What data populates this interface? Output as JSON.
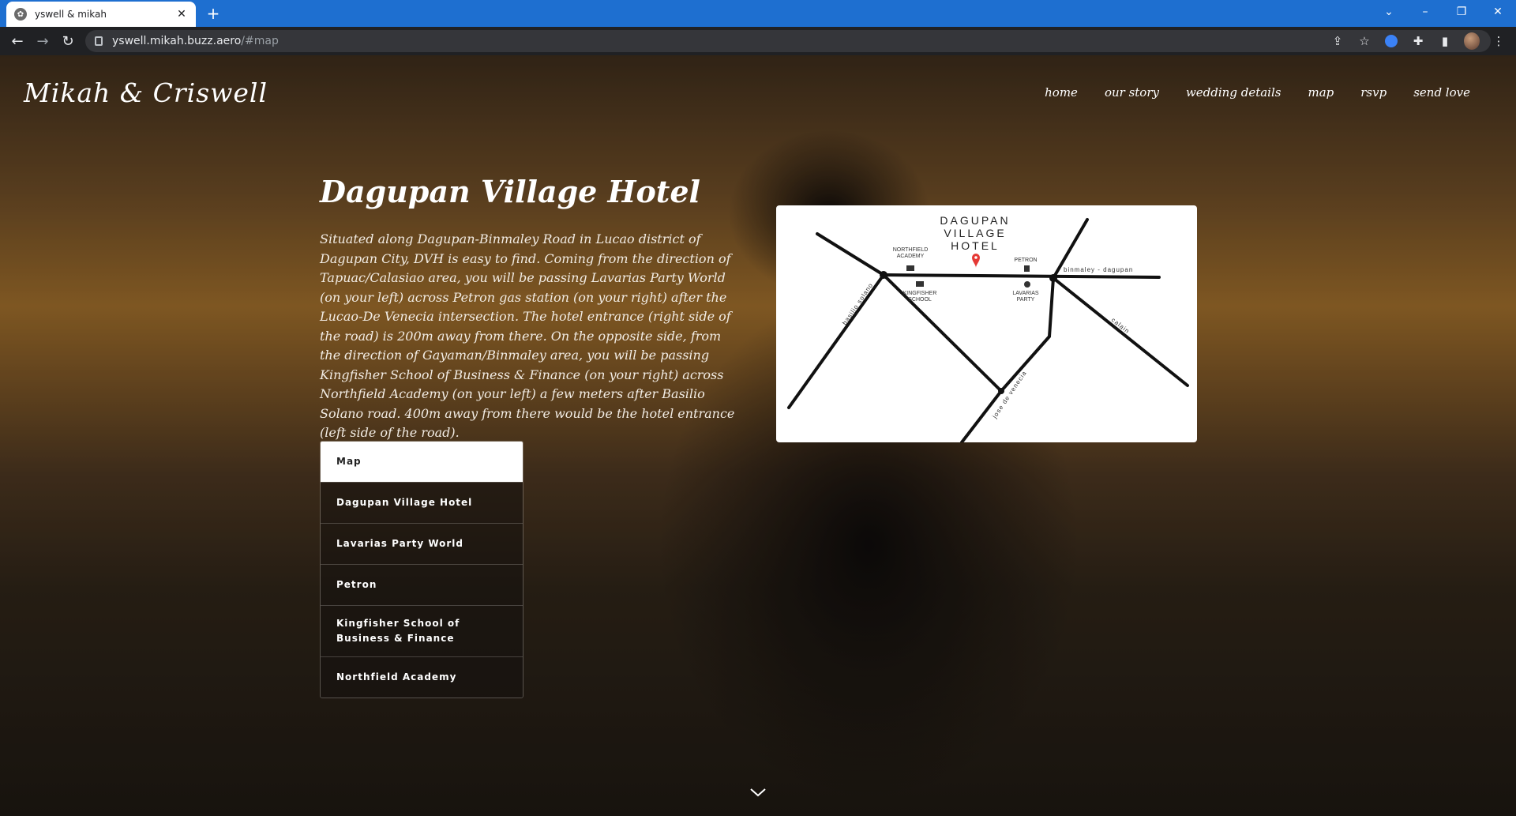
{
  "browser": {
    "tab_title": "yswell & mikah",
    "url_host": "yswell.mikah.buzz.aero",
    "url_path": "/#map"
  },
  "site": {
    "title": "Mikah & Criswell",
    "nav": [
      "home",
      "our story",
      "wedding details",
      "map",
      "rsvp",
      "send love"
    ]
  },
  "content": {
    "heading": "Dagupan Village Hotel",
    "description": "Situated along Dagupan-Binmaley Road in Lucao district of Dagupan City, DVH is easy to find. Coming from the direction of Tapuac/Calasiao area, you will be passing Lavarias Party World (on your left) across Petron gas station (on your right) after the Lucao-De Venecia intersection. The hotel entrance (right side of the road) is 200m away from there. On the opposite side, from the direction of Gayaman/Binmaley area, you will be passing Kingfisher School of Business & Finance (on your right) across Northfield Academy (on your left) a few meters after Basilio Solano road. 400m away from there would be the hotel entrance (left side of the road)."
  },
  "locations": [
    "Map",
    "Dagupan Village Hotel",
    "Lavarias Party World",
    "Petron",
    "Kingfisher School of Business & Finance",
    "Northfield Academy"
  ],
  "map": {
    "title_lines": [
      "DAGUPAN",
      "VILLAGE",
      "HOTEL"
    ],
    "labels": {
      "northfield_1": "NORTHFIELD",
      "northfield_2": "ACADEMY",
      "kingfisher_1": "KINGFISHER",
      "kingfisher_2": "SCHOOL",
      "petron": "PETRON",
      "lavarias_1": "LAVARIAS",
      "lavarias_2": "PARTY",
      "road_main": "binmaley - dagupan",
      "road_basilio": "basilio solano",
      "road_calain": "calain",
      "road_jose": "jose de venecia"
    },
    "pin_color": "#e53935"
  }
}
